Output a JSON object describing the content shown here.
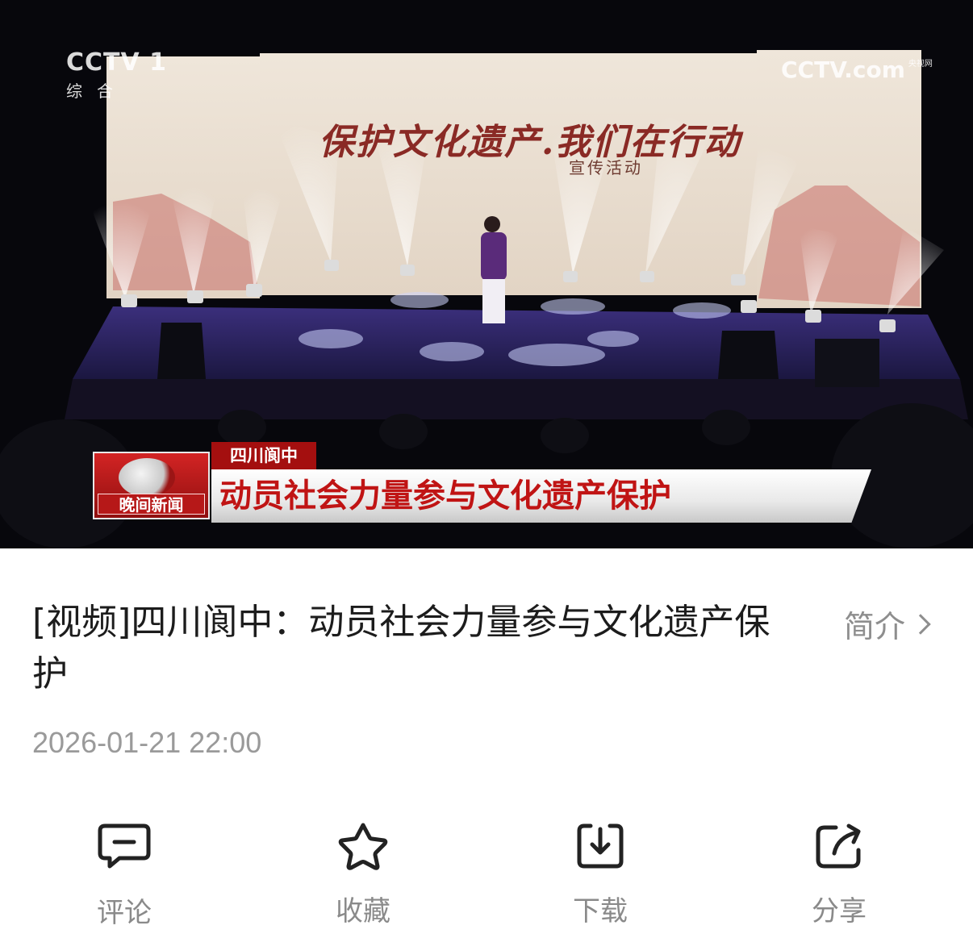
{
  "video": {
    "channel_logo": "CCTV 1",
    "channel_sub": "综合",
    "site_logo": "CCTV.com",
    "site_logo_small": "央视网",
    "stage_title": "保护文化遗产.我们在行动",
    "stage_subtitle": "宣传活动",
    "banner_program": "晚间新闻",
    "banner_location": "四川阆中",
    "banner_headline": "动员社会力量参与文化遗产保护"
  },
  "article": {
    "title": "[视频]四川阆中：动员社会力量参与文化遗产保护",
    "intro_link": "简介",
    "date": "2026-01-21 22:00"
  },
  "actions": [
    {
      "label": "评论",
      "icon": "comment-icon"
    },
    {
      "label": "收藏",
      "icon": "star-icon"
    },
    {
      "label": "下载",
      "icon": "download-icon"
    },
    {
      "label": "分享",
      "icon": "share-icon"
    }
  ],
  "colors": {
    "banner_red": "#c01414",
    "text_primary": "#1c1c1c",
    "text_secondary": "#8e8e8e",
    "icon_dark": "#222222"
  }
}
